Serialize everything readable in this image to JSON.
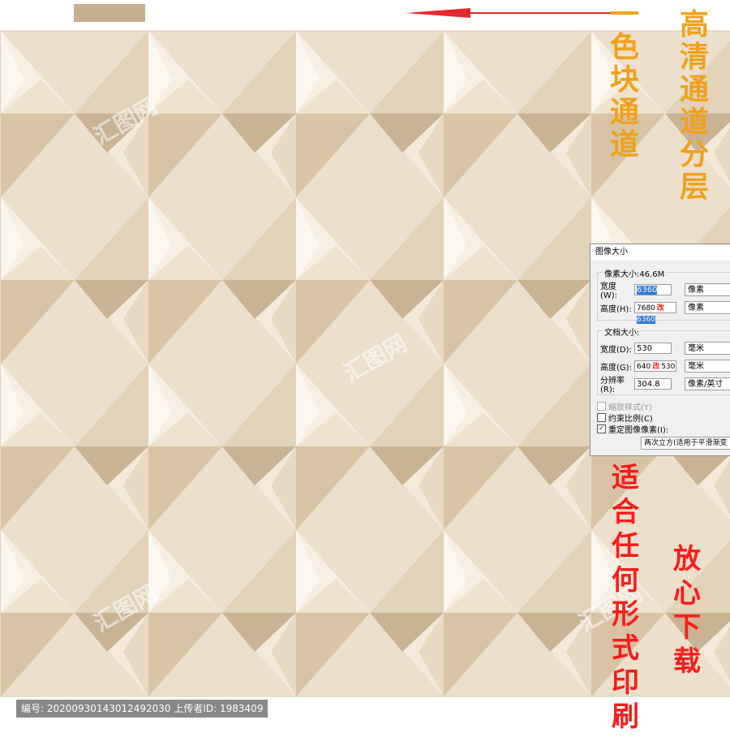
{
  "banner": {
    "swatch_color": "#c7b08f",
    "arrow_color": "#e8282a",
    "left_column_text": [
      "一",
      "色",
      "块",
      "通",
      "道"
    ],
    "right_column_text": [
      "高",
      "清",
      "通",
      "道",
      "分",
      "层"
    ],
    "bottom_left_text": [
      "适",
      "合",
      "任",
      "何",
      "形",
      "式",
      "印",
      "刷"
    ],
    "bottom_right_text": [
      "放",
      "心",
      "下",
      "载"
    ]
  },
  "dialog": {
    "title": "图像大小",
    "pixel_section_label": "像素大小:46.6M",
    "pixel_width_label": "宽度(W):",
    "pixel_width_value": "6360",
    "pixel_width_unit": "像素",
    "pixel_height_label": "高度(H):",
    "pixel_height_old": "7680",
    "pixel_height_mark": "改",
    "pixel_height_value": "6360",
    "pixel_height_unit": "像素",
    "doc_section_label": "文档大小:",
    "doc_width_label": "宽度(D):",
    "doc_width_value": "530",
    "doc_width_unit": "毫米",
    "doc_height_label": "高度(G):",
    "doc_height_old": "640",
    "doc_height_mark": "改",
    "doc_height_value": "530",
    "doc_height_unit": "毫米",
    "resolution_label": "分辨率(R):",
    "resolution_value": "304.8",
    "resolution_unit": "像素/英寸",
    "scale_styles_label": "缩放样式(Y)",
    "constrain_label": "约束比例(C)",
    "resample_label": "重定图像像素(I):",
    "resample_method": "两次立方(适用于平滑渐变"
  },
  "footer": {
    "text": "编号: 20200930143012492030 上传者ID: 1983409"
  },
  "watermark": {
    "text": "汇图网"
  }
}
